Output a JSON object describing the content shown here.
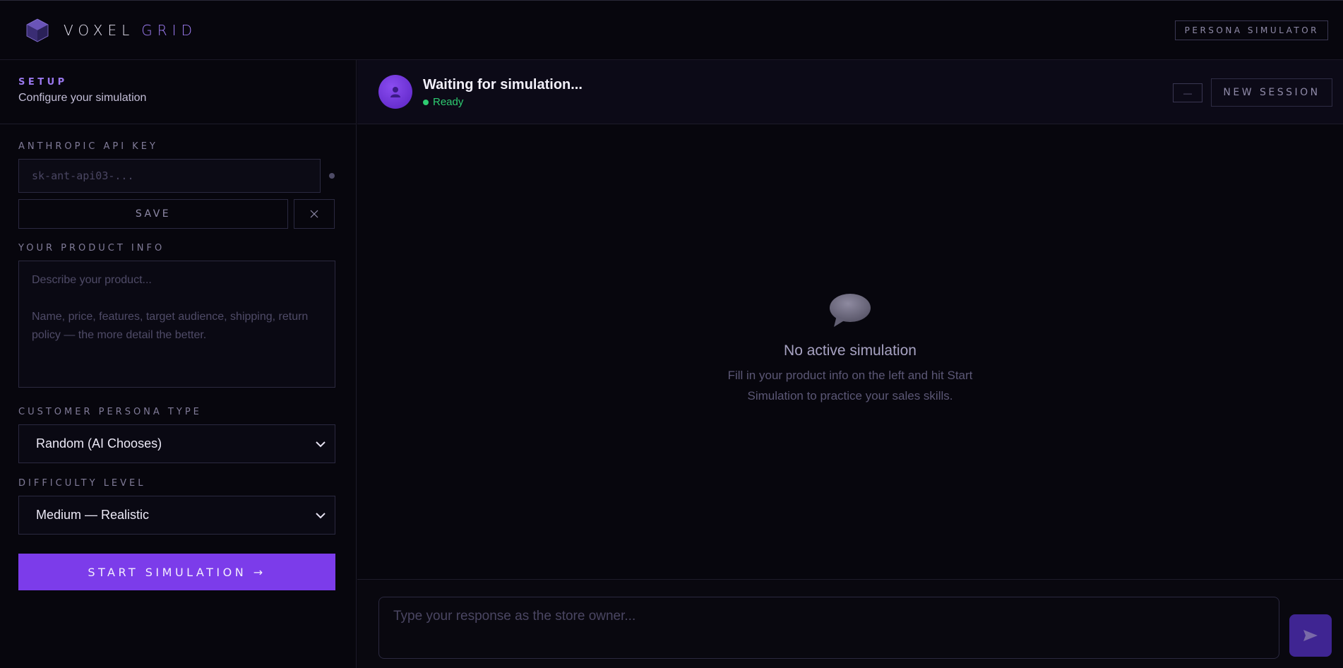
{
  "brand": {
    "word1": "VOXEL",
    "word2": "GRID",
    "badge": "PERSONA SIMULATOR",
    "logo_icon": "cube-icon"
  },
  "sidebar": {
    "eyebrow": "SETUP",
    "subtitle": "Configure your simulation",
    "api_key": {
      "label": "ANTHROPIC API KEY",
      "placeholder": "sk-ant-api03-...",
      "value": ""
    },
    "save_label": "SAVE",
    "clear_icon": "close-icon",
    "product": {
      "label": "YOUR PRODUCT INFO",
      "placeholder": "Describe your product...\n\nName, price, features, target audience, shipping, return policy — the more detail the better.",
      "value": ""
    },
    "persona": {
      "label": "CUSTOMER PERSONA TYPE",
      "selected": "Random (AI Chooses)"
    },
    "difficulty": {
      "label": "DIFFICULTY LEVEL",
      "selected": "Medium — Realistic"
    },
    "start_label": "START SIMULATION →"
  },
  "chat": {
    "title": "Waiting for simulation...",
    "status": "Ready",
    "minimize_label": "—",
    "new_session_label": "NEW SESSION",
    "empty": {
      "title": "No active simulation",
      "description": "Fill in your product info on the left and hit Start Simulation to practice your sales skills."
    },
    "composer": {
      "placeholder": "Type your response as the store owner...",
      "value": ""
    }
  },
  "colors": {
    "background": "#07060d",
    "accent": "#7c3cea",
    "accent_text": "#9d7cf2",
    "status_green": "#2ecc71",
    "send_button": "#3f2592"
  }
}
